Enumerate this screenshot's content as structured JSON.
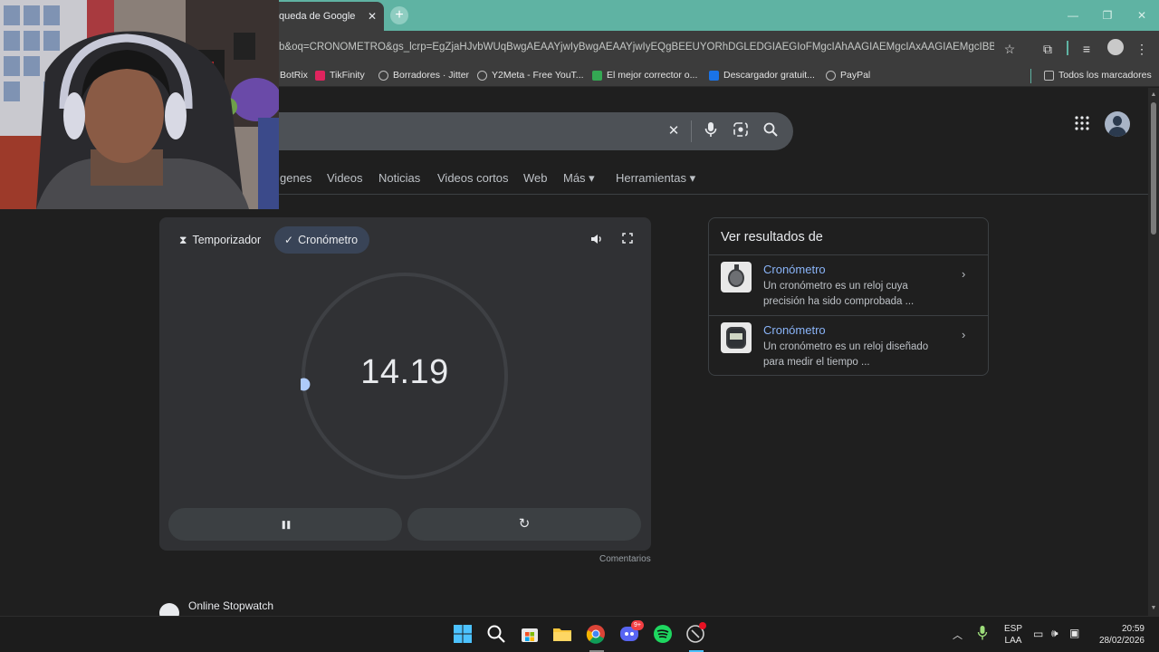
{
  "browser": {
    "tab_title": "queda de Google",
    "tab_close": "✕",
    "new_tab": "+",
    "url": "b&oq=CRONOMETRO&gs_lcrp=EgZjaHJvbWUqBwgAEAAYjwIyBwgAEAAYjwIyEQgBEEUYORhDGLEDGIAEGIoFMgcIAhAAGIAEMgcIAxAAGIAEMgcIBBAAGI..."
  },
  "bookmarks": [
    {
      "label": "BotRix",
      "color": "#3b3b3b"
    },
    {
      "label": "TikFinity",
      "color": "#e0245e"
    },
    {
      "label": "Borradores · Jitter",
      "color": "#9aa0a6"
    },
    {
      "label": "Y2Meta - Free YouT...",
      "color": "#9aa0a6"
    },
    {
      "label": "El mejor corrector o...",
      "color": "#34a853"
    },
    {
      "label": "Descargador gratuit...",
      "color": "#1a73e8"
    },
    {
      "label": "PayPal",
      "color": "#9aa0a6"
    },
    {
      "label": "Todos los marcadores",
      "color": "#9aa0a6"
    }
  ],
  "search_nav": {
    "tabs": [
      "genes",
      "Videos",
      "Noticias",
      "Videos cortos",
      "Web",
      "Más ▾",
      "Herramientas ▾"
    ]
  },
  "stopwatch": {
    "tab_timer": "Temporizador",
    "tab_stopwatch": "Cronómetro",
    "time": "14.19",
    "second_fraction": 0.2365,
    "comments": "Comentarios",
    "pause_glyph": "❚❚",
    "reset_glyph": "↻"
  },
  "side_panel": {
    "title": "Ver resultados de",
    "items": [
      {
        "link": "Cronómetro",
        "desc": "Un cronómetro es un reloj cuya precisión ha sido comprobada ..."
      },
      {
        "link": "Cronómetro",
        "desc": "Un cronómetro es un reloj diseñado para medir el tiempo ..."
      }
    ]
  },
  "results": {
    "online_stopwatch": "Online Stopwatch"
  },
  "taskbar": {
    "lang_top": "ESP",
    "lang_bottom": "LAA",
    "time": "20:59",
    "date": "28/02/2026",
    "discord_badge": "9+"
  },
  "colors": {
    "tab_strip": "#5fb3a3",
    "chrome_bg": "#3c3c3c",
    "page_bg": "#1f1f1f",
    "card_bg": "#303134",
    "selected_tab": "#394457",
    "link": "#8ab4f8",
    "dial_knob": "#aecbfa"
  }
}
